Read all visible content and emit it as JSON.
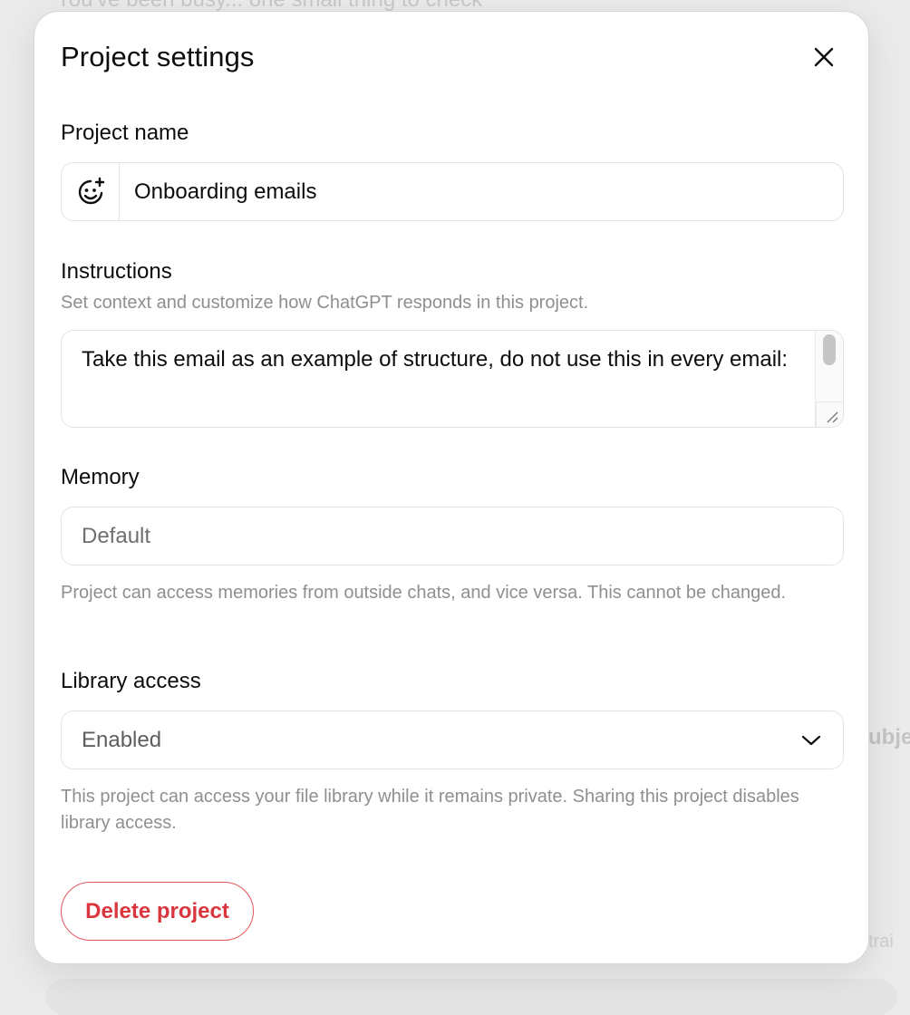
{
  "background": {
    "top_text": "You've been busy... one small thing to check",
    "side_text": "ubje",
    "side_text_bottom": "trai"
  },
  "modal": {
    "title": "Project settings",
    "close_icon": "close-icon",
    "project_name": {
      "label": "Project name",
      "emoji_icon": "add-emoji-icon",
      "value": "Onboarding emails"
    },
    "instructions": {
      "label": "Instructions",
      "hint": "Set context and customize how ChatGPT responds in this project.",
      "value": "Take this email as an example of structure, do not use this in every email:"
    },
    "memory": {
      "label": "Memory",
      "value": "Default",
      "hint": "Project can access memories from outside chats, and vice versa. This cannot be changed."
    },
    "library_access": {
      "label": "Library access",
      "value": "Enabled",
      "hint": "This project can access your file library while it remains private. Sharing this project disables library access."
    },
    "delete_label": "Delete project"
  },
  "colors": {
    "danger": "#d9363e",
    "muted_text": "#8f8f8f",
    "border": "#e3e3e3"
  }
}
